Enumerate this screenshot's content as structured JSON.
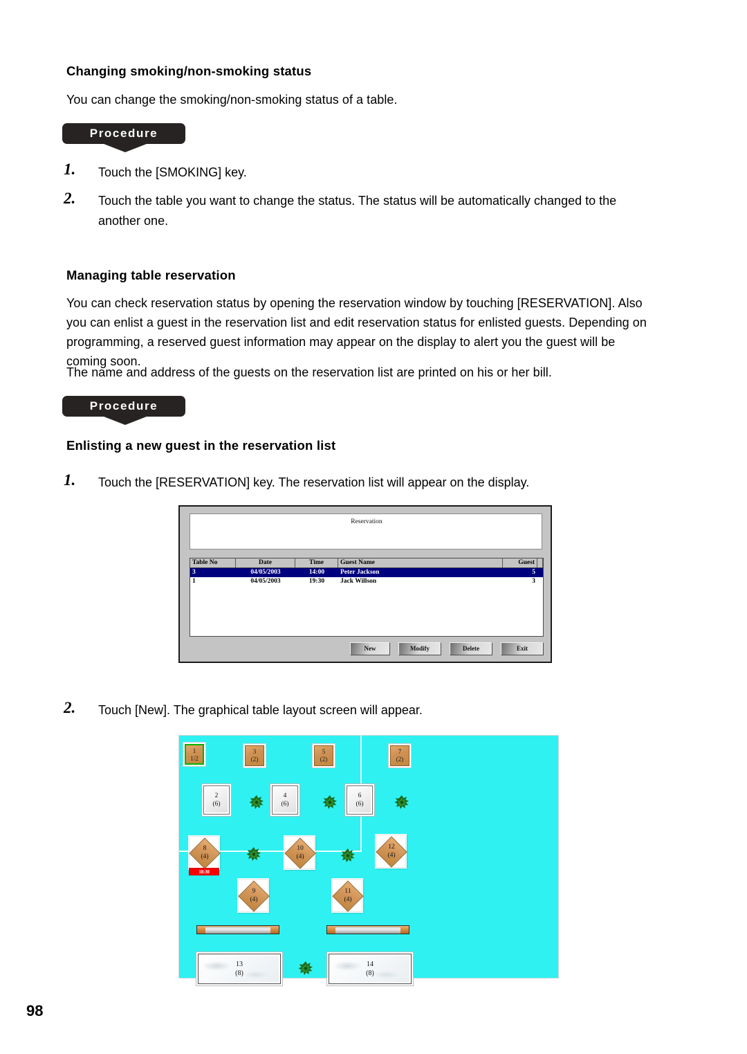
{
  "section1": {
    "heading": "Changing smoking/non-smoking status",
    "intro": "You can change the smoking/non-smoking status of a table.",
    "procedure_label": "Procedure",
    "steps": [
      {
        "num": "1.",
        "text": "Touch the [SMOKING] key."
      },
      {
        "num": "2.",
        "text": "Touch the table you want to change the status.  The status will be automatically changed to the another one."
      }
    ]
  },
  "section2": {
    "heading": "Managing table reservation",
    "body": "You can check reservation status by opening the reservation window by touching [RESERVATION]. Also you can enlist a guest in the reservation list and edit reservation status for enlisted guests. Depending on programming, a reserved guest information may appear on the display to alert you the guest will be coming soon.",
    "body_line5": "The name and address of the guests on the reservation list are printed on his or her bill.",
    "procedure_label": "Procedure",
    "subheading": "Enlisting a new guest in the reservation list",
    "steps": [
      {
        "num": "1.",
        "text": "Touch the [RESERVATION] key.  The reservation list will appear on the display."
      },
      {
        "num": "2.",
        "text": "Touch [New].  The graphical table layout screen will appear."
      }
    ]
  },
  "reservation_dialog": {
    "title": "Reservation",
    "columns": [
      "Table No",
      "Date",
      "Time",
      "Guest Name",
      "Guest"
    ],
    "rows": [
      {
        "table_no": "3",
        "date": "04/05/2003",
        "time": "14:00",
        "guest_name": "Peter Jackson",
        "guest": "5",
        "selected": true
      },
      {
        "table_no": "1",
        "date": "04/05/2003",
        "time": "19:30",
        "guest_name": "Jack Willson",
        "guest": "3",
        "selected": false
      }
    ],
    "buttons": [
      "New",
      "Modify",
      "Delete",
      "Exit"
    ],
    "selection_color": "#00007e"
  },
  "table_layout": {
    "background_color": "#2ff1f1",
    "tables": [
      {
        "id": "1",
        "label": "1",
        "seats": "1/2",
        "shape": "wood-square",
        "selected": true
      },
      {
        "id": "3",
        "label": "3",
        "seats": "(2)",
        "shape": "wood-square",
        "selected": false
      },
      {
        "id": "5",
        "label": "5",
        "seats": "(2)",
        "shape": "wood-square",
        "selected": false
      },
      {
        "id": "7",
        "label": "7",
        "seats": "(2)",
        "shape": "wood-square",
        "selected": false
      },
      {
        "id": "2",
        "label": "2",
        "seats": "(6)",
        "shape": "light-square",
        "selected": false
      },
      {
        "id": "4",
        "label": "4",
        "seats": "(6)",
        "shape": "light-square",
        "selected": false
      },
      {
        "id": "6",
        "label": "6",
        "seats": "(6)",
        "shape": "light-square",
        "selected": false
      },
      {
        "id": "8",
        "label": "8",
        "seats": "(4)",
        "shape": "diamond",
        "selected": false,
        "badge": "18:30"
      },
      {
        "id": "10",
        "label": "10",
        "seats": "(4)",
        "shape": "diamond",
        "selected": false
      },
      {
        "id": "12",
        "label": "12",
        "seats": "(4)",
        "shape": "diamond",
        "selected": false
      },
      {
        "id": "9",
        "label": "9",
        "seats": "(4)",
        "shape": "diamond",
        "selected": false
      },
      {
        "id": "11",
        "label": "11",
        "seats": "(4)",
        "shape": "diamond",
        "selected": false
      },
      {
        "id": "13",
        "label": "13",
        "seats": "(8)",
        "shape": "marble",
        "selected": false
      },
      {
        "id": "14",
        "label": "14",
        "seats": "(8)",
        "shape": "marble",
        "selected": false
      }
    ],
    "selected_border_color": "#00b300",
    "badge_color": "#f90000"
  },
  "footer": {
    "page_number": "98"
  }
}
